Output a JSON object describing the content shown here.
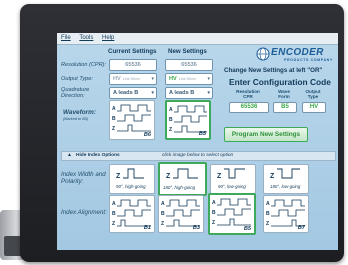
{
  "menu": {
    "file": "File",
    "tools": "Tools",
    "help": "Help"
  },
  "columns": {
    "current": "Current Settings",
    "new": "New Settings"
  },
  "resolution": {
    "label": "Resolution (CPR):",
    "current": "65536",
    "new": "65536"
  },
  "output_type": {
    "label": "Output Type:",
    "current": {
      "value": "HV",
      "sub": "Line Driver"
    },
    "new": {
      "value": "HV",
      "sub": "Line Driver"
    }
  },
  "quadrature": {
    "label": "Quadrature Direction:",
    "current": "A leads B",
    "new": "A leads B"
  },
  "waveform": {
    "label": "Waveform:",
    "sublabel": "(Marked to B5)",
    "current_tag": "B6",
    "new_tag": "B5"
  },
  "logo": {
    "name": "ENCODER",
    "sub": "PRODUCTS COMPANY"
  },
  "change_text": "Change New Settings at left \"OR\"",
  "config_title": "Enter Configuration Code",
  "config": {
    "headers": [
      "Resolution CPR",
      "Wave Form",
      "Output Type"
    ],
    "values": [
      "65536",
      "B5",
      "HV"
    ]
  },
  "program_button": "Program New Settings",
  "index_bar": {
    "toggle": "▲",
    "label": "Hide Index Options",
    "hint": "click image below to select option"
  },
  "index_width": {
    "label": "Index Width and Polarity:",
    "options": [
      "90°, high-going",
      "180°, high-going",
      "90°, low-going",
      "180°, low-going"
    ],
    "selected": "180°, high-going"
  },
  "index_alignment": {
    "label": "Index Alignment:",
    "options": [
      "B1",
      "B3",
      "B5",
      "B7"
    ],
    "selected": "B5"
  },
  "colors": {
    "accent_green": "#3ea95a",
    "screen_blue": "#b0d1e8",
    "brand_blue": "#1e5c97"
  },
  "icons": {
    "dropdown": "chevron-down-icon",
    "collapse": "triangle-up-icon"
  }
}
